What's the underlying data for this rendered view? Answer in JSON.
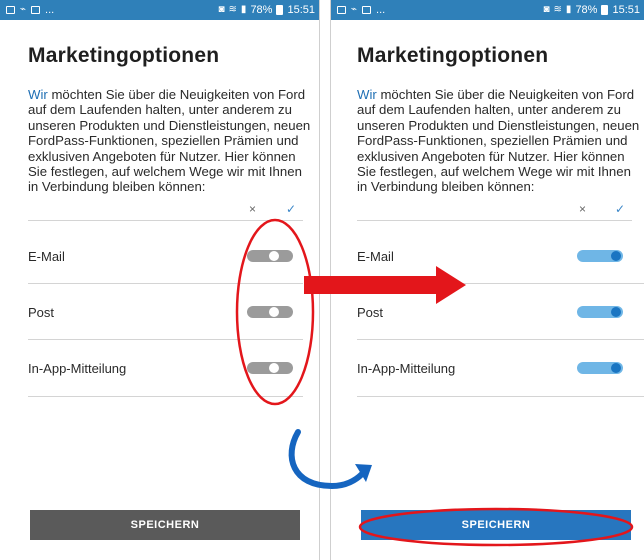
{
  "status_bar": {
    "left_glyph": "☁",
    "dots": "...",
    "sim_icon": "⚙",
    "wifi_icon": "≈",
    "signal_icon": ".▌",
    "battery_percent": "78%",
    "time": "15:51"
  },
  "screens": {
    "before": {
      "title": "Marketingoptionen",
      "intro_lead": "Wir",
      "intro_rest": " möchten Sie über die Neuigkeiten von Ford auf dem Laufenden halten, unter anderem zu unseren Produkten und Dienstleistungen, neuen FordPass-Funktionen, speziellen Prämien und exklusiven Angeboten für Nutzer. Hier können Sie festlegen, auf welchem Wege wir mit Ihnen in Verbindung bleiben können:",
      "col_x": "×",
      "col_check": "✓",
      "options": [
        {
          "label": "E-Mail",
          "enabled": false
        },
        {
          "label": "Post",
          "enabled": false
        },
        {
          "label": "In-App-Mitteilung",
          "enabled": false
        }
      ],
      "save_label": "SPEICHERN"
    },
    "after": {
      "title": "Marketingoptionen",
      "intro_lead": "Wir",
      "intro_rest": " möchten Sie über die Neuigkeiten von Ford auf dem Laufenden halten, unter anderem zu unseren Produkten und Dienstleistungen, neuen FordPass-Funktionen, speziellen Prämien und exklusiven Angeboten für Nutzer. Hier können Sie festlegen, auf welchem Wege wir mit Ihnen in Verbindung bleiben können:",
      "col_x": "×",
      "col_check": "✓",
      "options": [
        {
          "label": "E-Mail",
          "enabled": true
        },
        {
          "label": "Post",
          "enabled": true
        },
        {
          "label": "In-App-Mitteilung",
          "enabled": true
        }
      ],
      "save_label": "SPEICHERN"
    }
  },
  "colors": {
    "status_bar": "#2f80b9",
    "toggle_off": "#9b9b9b",
    "toggle_on_track": "#6fb6e6",
    "toggle_on_knob": "#1a75c2",
    "save_disabled": "#5a5a5a",
    "save_enabled": "#2776bf",
    "annotation_red": "#e3161b",
    "annotation_blue": "#1565c0"
  }
}
